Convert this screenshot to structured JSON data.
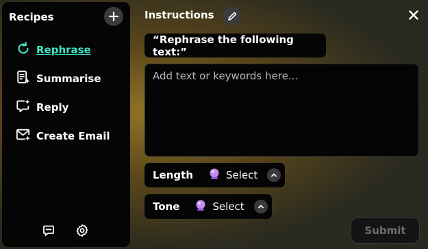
{
  "sidebar": {
    "title": "Recipes",
    "add_icon": "plus-icon",
    "items": [
      {
        "label": "Rephrase",
        "icon": "refresh-icon",
        "active": true
      },
      {
        "label": "Summarise",
        "icon": "document-sparkle-icon",
        "active": false
      },
      {
        "label": "Reply",
        "icon": "chat-sparkle-icon",
        "active": false
      },
      {
        "label": "Create Email",
        "icon": "mail-sparkle-icon",
        "active": false
      }
    ],
    "bottom_icons": [
      "feedback-icon",
      "settings-icon"
    ]
  },
  "main": {
    "title": "Instructions",
    "edit_icon": "pencil-icon",
    "close_icon": "close-icon",
    "prompt": "“Rephrase the following text:”",
    "input_placeholder": "Add text or keywords here...",
    "length": {
      "label": "Length",
      "value": "Select",
      "icon": "crystal-ball-icon"
    },
    "tone": {
      "label": "Tone",
      "value": "Select",
      "icon": "crystal-ball-icon"
    },
    "submit_label": "Submit"
  },
  "colors": {
    "accent": "#3fe6c8",
    "panel": "#050505"
  }
}
